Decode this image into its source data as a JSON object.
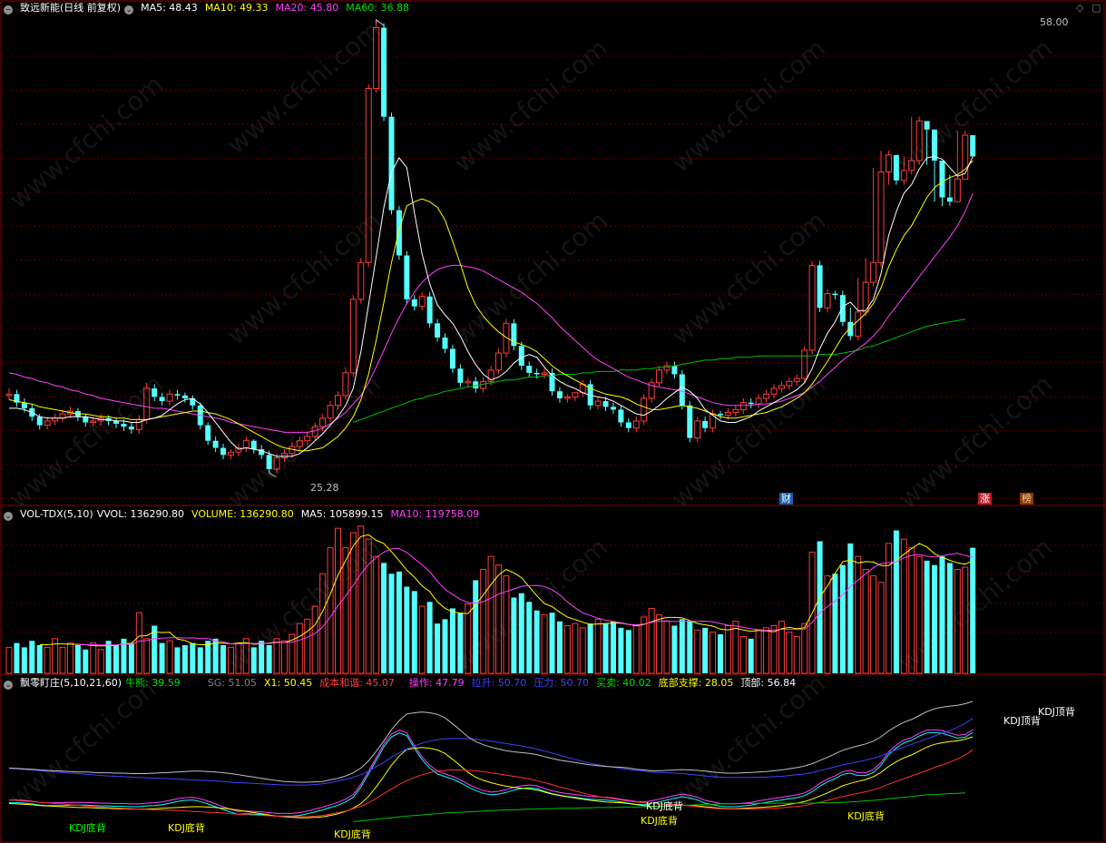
{
  "header": {
    "stock_name": "致远新能(日线 前复权)",
    "ma5": "MA5: 48.43",
    "ma10": "MA10: 49.33",
    "ma20": "MA20: 45.80",
    "ma60": "MA60: 36.88"
  },
  "vol_header": {
    "name": "VOL-TDX(5,10)",
    "vvol": "VVOL: 136290.80",
    "volume": "VOLUME: 136290.80",
    "ma5": "MA5: 105899.15",
    "ma10": "MA10: 119758.09"
  },
  "ind_header": {
    "name": "飘零盯庄(5,10,21,60)",
    "niuxiong": "牛熊: 39.59",
    "sg": "SG: 51.05",
    "x1": "X1: 50.45",
    "chengben": "成本和谐: 45.07",
    "caozuo": "操作: 47.79",
    "tisheng": "拉升: 50.70",
    "yali": "压力: 50.70",
    "maimai": "买卖: 40.02",
    "dibu": "底部支撑: 28.05",
    "dingbu": "顶部: 56.84"
  },
  "markers": {
    "high": "58.00",
    "low": "25.28",
    "cai": "财",
    "zhang": "涨",
    "bang": "榜"
  },
  "signals": {
    "kdj_bottom": "KDJ底背",
    "kdj_top": "KDJ顶背"
  },
  "watermark": "www.cfchi.com",
  "colors": {
    "up": "#ff3c3c",
    "down": "#54ffff",
    "ma5": "#ffffff",
    "ma10": "#ffff00",
    "ma20": "#ff40ff",
    "ma60": "#00c000"
  },
  "chart_data": {
    "type": "candlestick",
    "open": [
      31.5,
      31.6,
      31,
      30.6,
      30,
      29.4,
      29.7,
      29.9,
      30.2,
      30.4,
      30,
      29.6,
      29.7,
      29.9,
      29.7,
      29.5,
      29.3,
      29.1,
      29.8,
      32,
      31.4,
      31.1,
      31.6,
      31.5,
      31.3,
      30.8,
      29.4,
      28.3,
      27.8,
      27.3,
      27.5,
      27.8,
      28.3,
      27.7,
      27.3,
      26.3,
      27.1,
      27.4,
      27.9,
      28.3,
      28.6,
      29.3,
      29.9,
      30.8,
      31.5,
      33.1,
      38.3,
      40.9,
      53.2,
      57.5,
      51.2,
      44.6,
      41.4,
      38.3,
      37.8,
      38.5,
      36.6,
      35.6,
      34.8,
      33.4,
      32.4,
      32.5,
      32,
      32.5,
      33.3,
      34.5,
      36.6,
      35,
      33.6,
      33.1,
      33,
      33.1,
      31.8,
      31.3,
      31.4,
      31.7,
      32.3,
      30.8,
      31.1,
      30.7,
      30.5,
      29.6,
      29.2,
      29.7,
      31.3,
      32.4,
      33.3,
      33.6,
      33,
      30.8,
      28.5,
      29.7,
      29.2,
      30.2,
      30.1,
      30.3,
      30.5,
      31,
      30.9,
      31.3,
      31.6,
      32,
      32.2,
      32.5,
      32.7,
      34.7,
      40.7,
      37.7,
      38.7,
      38.6,
      36.7,
      35.7,
      37.4,
      39.5,
      40.9,
      47.3,
      48.5,
      46.7,
      47.4,
      48.1,
      50.9,
      50.3,
      48.1,
      45.5,
      45.2,
      46.8,
      49.9
    ],
    "close": [
      31.6,
      31,
      30.6,
      30,
      29.4,
      29.7,
      29.9,
      30.2,
      30.4,
      30,
      29.6,
      29.7,
      29.9,
      29.7,
      29.5,
      29.3,
      29.1,
      29.8,
      32,
      31.4,
      31.1,
      31.6,
      31.5,
      31.3,
      30.8,
      29.4,
      28.3,
      27.8,
      27.3,
      27.5,
      27.8,
      28.3,
      27.7,
      27.3,
      26.3,
      27.1,
      27.4,
      27.9,
      28.3,
      28.6,
      29.3,
      29.9,
      30.8,
      31.5,
      33.1,
      38.3,
      40.9,
      53.2,
      57.5,
      51.2,
      44.6,
      41.4,
      38.3,
      37.8,
      38.5,
      36.6,
      35.6,
      34.8,
      33.4,
      32.4,
      32.5,
      32,
      32.5,
      33.3,
      34.5,
      36.6,
      35,
      33.6,
      33.1,
      33,
      33.1,
      31.8,
      31.3,
      31.4,
      31.7,
      32.3,
      30.8,
      31.1,
      30.7,
      30.5,
      29.6,
      29.2,
      29.7,
      31.3,
      32.4,
      33.3,
      33.6,
      33,
      30.8,
      28.5,
      29.7,
      29.2,
      30.2,
      30.1,
      30.3,
      30.5,
      31,
      30.9,
      31.3,
      31.6,
      32,
      32.2,
      32.5,
      32.7,
      34.7,
      40.7,
      37.7,
      38.7,
      38.6,
      36.7,
      35.7,
      37.4,
      39.5,
      40.9,
      47.3,
      48.5,
      46.7,
      47.4,
      48.1,
      50.9,
      50.3,
      48.1,
      45.5,
      45.2,
      46.8,
      49.9,
      48.4
    ],
    "high": [
      32.0,
      31.9,
      31.3,
      30.9,
      30.2,
      30.0,
      30.2,
      30.5,
      30.7,
      30.6,
      30.2,
      30.0,
      30.2,
      30.1,
      29.9,
      29.8,
      29.6,
      30.1,
      32.4,
      32.3,
      31.7,
      31.9,
      31.9,
      31.7,
      31.5,
      31.0,
      29.6,
      28.6,
      28.1,
      27.7,
      28.1,
      28.6,
      28.4,
      28.0,
      27.6,
      27.4,
      27.7,
      28.2,
      28.6,
      28.9,
      29.6,
      30.2,
      31.1,
      31.8,
      33.5,
      38.6,
      41.2,
      53.5,
      57.8,
      57.8,
      51.5,
      44.9,
      41.7,
      38.6,
      38.8,
      38.8,
      36.9,
      35.9,
      35.1,
      33.7,
      32.8,
      32.8,
      32.8,
      33.6,
      34.8,
      36.9,
      36.9,
      35.3,
      33.9,
      33.4,
      33.4,
      33.4,
      32.1,
      31.6,
      31.7,
      32.6,
      32.6,
      31.4,
      31.4,
      31.0,
      30.8,
      29.9,
      30.0,
      31.6,
      32.7,
      33.6,
      33.9,
      33.9,
      33.3,
      31.1,
      30.0,
      30.0,
      30.5,
      30.4,
      30.6,
      30.8,
      31.3,
      31.3,
      31.6,
      31.9,
      32.3,
      32.5,
      32.8,
      33.0,
      35.0,
      41.0,
      41.0,
      39.0,
      38.9,
      38.9,
      37.7,
      39.8,
      41.2,
      47.6,
      48.8,
      48.8,
      47.7,
      48.4,
      51.2,
      51.2,
      50.6,
      48.4,
      45.8,
      47.1,
      50.2,
      50.2
    ],
    "low": [
      31.2,
      30.7,
      30.3,
      29.7,
      29.1,
      29.1,
      29.4,
      29.6,
      29.9,
      29.7,
      29.3,
      29.3,
      29.4,
      29.4,
      29.2,
      29.0,
      28.8,
      28.8,
      29.5,
      31.1,
      30.8,
      30.8,
      31.2,
      31.0,
      30.5,
      29.1,
      28.0,
      27.5,
      27.0,
      27.0,
      27.2,
      27.5,
      27.4,
      27.0,
      26.0,
      26.0,
      26.8,
      27.1,
      27.6,
      28.0,
      28.3,
      29.0,
      29.6,
      30.5,
      31.2,
      32.8,
      38.0,
      40.6,
      52.9,
      50.9,
      44.3,
      41.1,
      38.0,
      37.5,
      37.5,
      36.3,
      35.3,
      34.5,
      33.1,
      32.1,
      32.1,
      31.7,
      31.7,
      32.2,
      33.0,
      34.2,
      34.7,
      33.3,
      32.8,
      32.7,
      32.7,
      31.5,
      31.0,
      31.0,
      31.1,
      31.4,
      30.5,
      30.5,
      30.4,
      30.2,
      29.3,
      28.9,
      28.9,
      29.4,
      31.0,
      32.1,
      33.0,
      32.7,
      30.5,
      28.2,
      28.2,
      28.9,
      28.9,
      29.8,
      29.8,
      30.0,
      30.2,
      30.6,
      30.6,
      31.0,
      31.3,
      31.7,
      31.9,
      32.2,
      32.4,
      34.4,
      37.4,
      37.4,
      38.3,
      36.4,
      35.4,
      35.4,
      37.1,
      39.2,
      40.6,
      46.4,
      46.4,
      46.4,
      47.1,
      47.8,
      47.8,
      45.2,
      44.9,
      44.9,
      46.5,
      48.1
    ],
    "volume": [
      12,
      14,
      12,
      15,
      13,
      12,
      16,
      12,
      14,
      13,
      11,
      14,
      11,
      15,
      13,
      16,
      14,
      28,
      16,
      22,
      14,
      15,
      12,
      13,
      14,
      12,
      15,
      16,
      13,
      12,
      14,
      16,
      12,
      15,
      13,
      16,
      15,
      18,
      23,
      25,
      31,
      46,
      58,
      67,
      58,
      65,
      68,
      62,
      54,
      51,
      46,
      47,
      40,
      38,
      31,
      33,
      23,
      25,
      30,
      28,
      32,
      43,
      48,
      54,
      50,
      45,
      35,
      37,
      33,
      29,
      27,
      28,
      24,
      22,
      23,
      21,
      23,
      25,
      23,
      24,
      21,
      20,
      22,
      26,
      30,
      27,
      24,
      22,
      25,
      24,
      20,
      21,
      19,
      18,
      22,
      24,
      17,
      16,
      20,
      21,
      22,
      24,
      19,
      17,
      23,
      56,
      61,
      45,
      46,
      50,
      60,
      54,
      48,
      45,
      42,
      60,
      66,
      62,
      58,
      54,
      52,
      50,
      54,
      51,
      48,
      49,
      58
    ],
    "ma5": [
      30.6,
      30.6,
      30.5,
      30.3,
      30.0,
      29.9,
      29.9,
      29.9,
      30.0,
      30.0,
      30.0,
      29.9,
      29.8,
      29.8,
      29.7,
      29.7,
      29.6,
      29.6,
      29.8,
      29.9,
      30.1,
      30.5,
      30.9,
      31.2,
      31.3,
      30.9,
      30.3,
      29.6,
      28.9,
      28.2,
      27.7,
      27.8,
      27.7,
      27.6,
      27.4,
      27.2,
      27.2,
      27.2,
      27.4,
      27.8,
      28.3,
      28.8,
      29.4,
      30.0,
      30.8,
      32.0,
      34.6,
      37.9,
      41.3,
      44.8,
      47.3,
      48.3,
      47.6,
      44.4,
      41.5,
      39.4,
      37.9,
      37.2,
      36.6,
      35.7,
      34.6,
      33.7,
      33.0,
      32.6,
      32.8,
      33.2,
      33.8,
      34.2,
      34.4,
      34.2,
      33.5,
      32.9,
      32.5,
      32.2,
      32.0,
      31.7,
      31.5,
      31.4,
      31.3,
      31.1,
      30.8,
      30.5,
      30.2,
      30.1,
      30.4,
      30.8,
      31.3,
      31.7,
      32.1,
      31.8,
      31.3,
      30.5,
      30.1,
      29.7,
      29.6,
      29.6,
      29.8,
      30.0,
      30.4,
      30.7,
      31.0,
      31.3,
      31.6,
      31.9,
      32.4,
      33.4,
      34.8,
      35.9,
      36.7,
      37.8,
      38.1,
      37.5,
      37.5,
      38.3,
      40.1,
      42.8,
      44.5,
      45.8,
      46.4,
      47.5,
      48.3,
      48.4,
      48.2,
      47.6,
      47.0,
      47.2,
      48.4
    ],
    "ma10": [
      31.2,
      31.1,
      31.0,
      30.9,
      30.7,
      30.6,
      30.5,
      30.4,
      30.3,
      30.2,
      30.2,
      30.1,
      30.0,
      30.0,
      29.9,
      29.9,
      29.8,
      29.8,
      29.8,
      29.9,
      30.0,
      30.1,
      30.2,
      30.3,
      30.4,
      30.4,
      30.3,
      30.2,
      30.0,
      29.8,
      29.5,
      29.2,
      28.9,
      28.6,
      28.3,
      28.0,
      27.8,
      27.7,
      27.6,
      27.6,
      27.7,
      27.8,
      28.2,
      28.6,
      29.2,
      30.0,
      31.2,
      33.0,
      35.4,
      38.1,
      40.9,
      43.2,
      44.9,
      45.2,
      45.4,
      45.2,
      44.8,
      43.9,
      42.4,
      40.8,
      39.1,
      37.9,
      37.1,
      36.5,
      36.0,
      35.6,
      35.3,
      35.1,
      34.9,
      34.6,
      34.1,
      33.6,
      33.2,
      32.9,
      32.6,
      32.3,
      32.0,
      31.8,
      31.6,
      31.5,
      31.4,
      31.2,
      30.9,
      30.7,
      30.5,
      30.5,
      30.6,
      30.7,
      30.8,
      30.7,
      30.6,
      30.4,
      30.2,
      30.0,
      29.9,
      29.9,
      30.0,
      30.1,
      30.2,
      30.3,
      30.5,
      30.7,
      31.0,
      31.3,
      31.7,
      32.3,
      33.1,
      33.9,
      34.8,
      35.7,
      36.3,
      36.8,
      37.3,
      38.0,
      39.1,
      40.6,
      41.8,
      42.8,
      43.5,
      44.5,
      45.5,
      46.2,
      46.6,
      46.9,
      47.1,
      47.5,
      48.1
    ],
    "ma20": [
      33.1,
      33.0,
      32.8,
      32.7,
      32.5,
      32.4,
      32.2,
      32.1,
      31.9,
      31.8,
      31.6,
      31.5,
      31.3,
      31.2,
      31.1,
      31.0,
      30.9,
      30.8,
      30.7,
      30.6,
      30.6,
      30.5,
      30.4,
      30.3,
      30.2,
      30.1,
      30.0,
      29.9,
      29.8,
      29.6,
      29.5,
      29.4,
      29.3,
      29.2,
      29.1,
      29.0,
      28.9,
      28.9,
      28.9,
      28.9,
      29.0,
      29.2,
      29.5,
      29.9,
      30.3,
      30.9,
      31.5,
      32.4,
      33.5,
      34.7,
      35.9,
      37.0,
      38.0,
      38.8,
      39.5,
      40.0,
      40.4,
      40.6,
      40.7,
      40.7,
      40.6,
      40.5,
      40.3,
      40.0,
      39.7,
      39.4,
      39.1,
      38.8,
      38.4,
      38.0,
      37.5,
      37.0,
      36.4,
      35.9,
      35.4,
      34.9,
      34.4,
      34.0,
      33.7,
      33.4,
      33.1,
      32.8,
      32.6,
      32.4,
      32.2,
      32.1,
      32.0,
      31.9,
      31.8,
      31.6,
      31.4,
      31.2,
      31.0,
      30.9,
      30.8,
      30.8,
      30.8,
      30.8,
      30.9,
      30.9,
      31.0,
      31.1,
      31.3,
      31.5,
      31.7,
      32.1,
      32.5,
      33.0,
      33.5,
      34.0,
      34.4,
      34.8,
      35.2,
      35.7,
      36.3,
      37.1,
      37.8,
      38.5,
      39.2,
      39.9,
      40.6,
      41.3,
      42.0,
      42.7,
      43.5,
      44.5,
      45.8
    ],
    "ma60": [
      null,
      null,
      null,
      null,
      null,
      null,
      null,
      null,
      null,
      null,
      null,
      null,
      null,
      null,
      null,
      null,
      null,
      null,
      null,
      null,
      null,
      null,
      null,
      null,
      null,
      null,
      null,
      null,
      null,
      null,
      null,
      null,
      null,
      null,
      null,
      null,
      null,
      null,
      null,
      null,
      null,
      null,
      null,
      null,
      null,
      29.6,
      29.8,
      30.0,
      30.2,
      30.4,
      30.6,
      30.8,
      31.0,
      31.2,
      31.3,
      31.5,
      31.6,
      31.8,
      31.9,
      32.0,
      32.1,
      32.2,
      32.3,
      32.4,
      32.5,
      32.6,
      32.6,
      32.7,
      32.8,
      32.8,
      32.9,
      32.9,
      33.0,
      33.0,
      33.0,
      33.1,
      33.1,
      33.2,
      33.2,
      33.2,
      33.3,
      33.3,
      33.3,
      33.4,
      33.4,
      33.5,
      33.5,
      33.6,
      33.7,
      33.8,
      33.9,
      34.0,
      34.0,
      34.1,
      34.1,
      34.2,
      34.2,
      34.2,
      34.3,
      34.3,
      34.3,
      34.3,
      34.3,
      34.3,
      34.3,
      34.3,
      34.4,
      34.4,
      34.4,
      34.5,
      34.6,
      34.7,
      34.9,
      35.0,
      35.2,
      35.4,
      35.6,
      35.8,
      36.0,
      36.2,
      36.4,
      36.5,
      36.6,
      36.7,
      36.8,
      36.9
    ]
  }
}
